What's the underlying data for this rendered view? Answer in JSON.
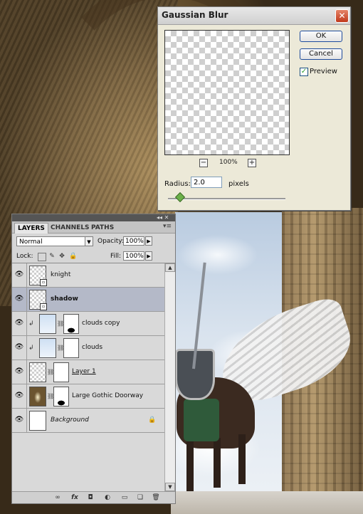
{
  "blur_dialog": {
    "title": "Gaussian Blur",
    "close_glyph": "✕",
    "ok_label": "OK",
    "cancel_label": "Cancel",
    "preview_label": "Preview",
    "preview_checked": true,
    "zoom_out_glyph": "−",
    "zoom_in_glyph": "+",
    "zoom_level": "100%",
    "radius_label": "Radius:",
    "radius_value": "2.0",
    "radius_unit": "pixels",
    "radius_slider_fraction": 0.02
  },
  "layers_panel": {
    "top_controls": "◂◂ ✕",
    "tabs": [
      "LAYERS",
      "CHANNELS",
      "PATHS"
    ],
    "active_tab": "LAYERS",
    "menu_glyph": "▾≡",
    "blend_mode": "Normal",
    "opacity_label": "Opacity:",
    "opacity_value": "100%",
    "lock_label": "Lock:",
    "fill_label": "Fill:",
    "fill_value": "100%",
    "lock_icons": [
      "transparency-lock-icon",
      "brush-lock-icon",
      "move-lock-icon",
      "padlock-icon"
    ],
    "layers": [
      {
        "name": "knight",
        "selected": false,
        "thumb": "checker",
        "smart_object": true
      },
      {
        "name": "shadow",
        "selected": true,
        "thumb": "checker",
        "smart_object": true
      },
      {
        "name": "clouds copy",
        "selected": false,
        "thumb": "sky",
        "mask": "black-spot",
        "clipped": true
      },
      {
        "name": "clouds",
        "selected": false,
        "thumb": "sky",
        "mask": "white",
        "clipped": true
      },
      {
        "name": "Layer 1",
        "selected": false,
        "thumb": "checker",
        "mask": "white"
      },
      {
        "name": "Large Gothic Doorway",
        "selected": false,
        "thumb": "door",
        "mask": "black-spot"
      },
      {
        "name": "Background",
        "selected": false,
        "thumb": "white",
        "locked": true
      }
    ],
    "footer_icons": [
      "link-layers-icon",
      "fx-icon",
      "add-mask-icon",
      "adjustment-layer-icon",
      "new-group-icon",
      "new-layer-icon",
      "trash-icon"
    ],
    "footer_glyphs": [
      "∞",
      "fx",
      "◘",
      "◐",
      "▭",
      "❏",
      "🗑"
    ]
  },
  "colors": {
    "selected_layer": "#b4b9c8",
    "dialog_bg": "#ece9d8",
    "ok_border": "#1e4b9c"
  }
}
